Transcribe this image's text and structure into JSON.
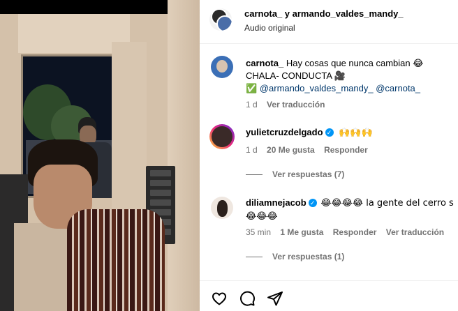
{
  "header": {
    "title": "carnota_ y armando_valdes_mandy_",
    "subtitle": "Audio original"
  },
  "caption": {
    "username": "carnota_",
    "line1": "Hay cosas que nunca cambian 😂",
    "line2": "CHALA- CONDUCTA 🎥",
    "check": "✅",
    "mention1": "@armando_valdes_mandy_",
    "mention2": "@carnota_",
    "time": "1 d",
    "translate": "Ver traducción"
  },
  "comments": [
    {
      "username": "yulietcruzdelgado",
      "verified": true,
      "text": "🙌🙌🙌",
      "time": "1 d",
      "likes": "20 Me gusta",
      "reply": "Responder",
      "view_replies": "Ver respuestas (7)"
    },
    {
      "username": "diliamnejacob",
      "verified": true,
      "text_line1": "😂😂😂😂 la gente del cerro s",
      "text_line2": "😂😂😂",
      "time": "35 min",
      "likes": "1 Me gusta",
      "reply": "Responder",
      "translate": "Ver traducción",
      "view_replies": "Ver respuestas (1)"
    }
  ],
  "actions": {
    "like_icon": "heart-icon",
    "comment_icon": "comment-icon",
    "share_icon": "share-icon"
  },
  "colors": {
    "verified": "#0095f6",
    "muted": "#737373",
    "link": "#00376b"
  }
}
